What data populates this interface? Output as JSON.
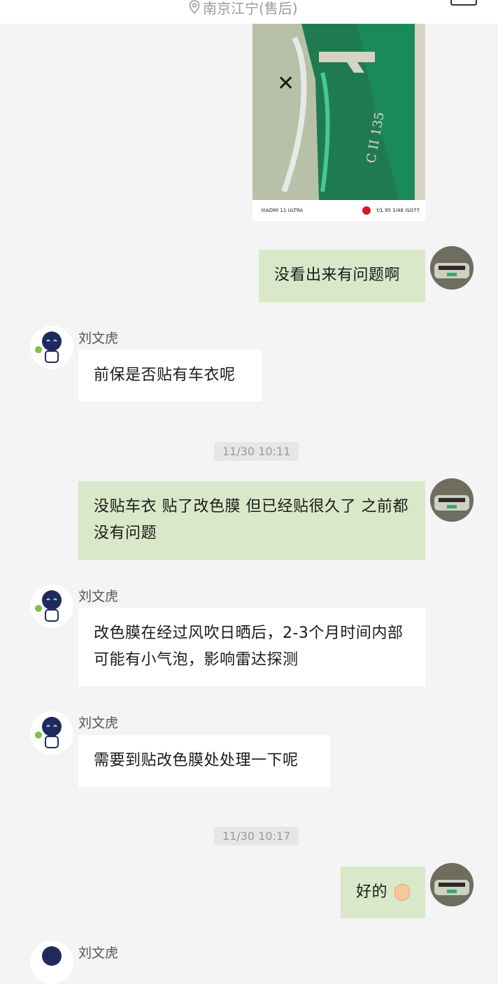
{
  "header": {
    "location": "南京江宁(售后)"
  },
  "photo": {
    "model": "XIAOMI 11 ULTRA",
    "exif": "f/1.95  1/48  ISO77",
    "plate": "C II 135"
  },
  "messages": [
    {
      "sender": "",
      "text": "没看出来有问题啊"
    },
    {
      "sender": "刘文虎",
      "text": "前保是否贴有车衣呢"
    },
    {
      "sender": "",
      "text": "没贴车衣 贴了改色膜  但已经贴很久了 之前都没有问题"
    },
    {
      "sender": "刘文虎",
      "text": "改色膜在经过风吹日晒后，2-3个月时间内部可能有小气泡，影响雷达探测"
    },
    {
      "sender": "刘文虎",
      "text": "需要到贴改色膜处处理一下呢"
    },
    {
      "sender": "",
      "text": "好的"
    },
    {
      "sender": "刘文虎",
      "text": ""
    }
  ],
  "timestamps": [
    "11/30 10:11",
    "11/30 10:17"
  ],
  "icons": {
    "location": "location-pin-icon",
    "emoji": "ok-hand-emoji-icon"
  },
  "colors": {
    "my_bubble": "#d8e8c8",
    "their_bubble": "#ffffff",
    "background": "#f4f4f4"
  }
}
